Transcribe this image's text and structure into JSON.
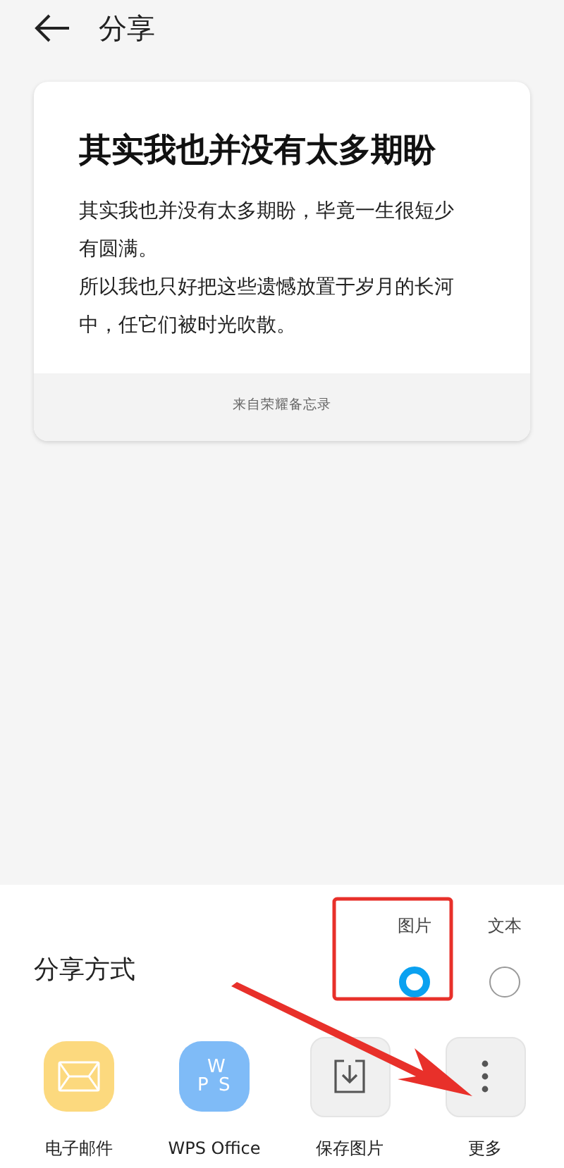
{
  "header": {
    "title": "分享"
  },
  "note": {
    "title": "其实我也并没有太多期盼",
    "paragraphs": [
      [
        "其实我也并没有太多期盼，毕竟一生很短少",
        "有圆满。"
      ],
      [
        "所以我也只好把这些遗憾放置于岁月的长河",
        "中，任它们被时光吹散。"
      ]
    ],
    "footer": "来自荣耀备忘录"
  },
  "share": {
    "label": "分享方式",
    "options": [
      {
        "label": "图片",
        "selected": true
      },
      {
        "label": "文本",
        "selected": false
      }
    ],
    "targets": [
      {
        "kind": "mail",
        "label": "电子邮件"
      },
      {
        "kind": "wps",
        "label": "WPS Office",
        "letters": [
          "W",
          "P",
          "S"
        ]
      },
      {
        "kind": "save",
        "label": "保存图片"
      },
      {
        "kind": "more",
        "label": "更多"
      }
    ]
  }
}
